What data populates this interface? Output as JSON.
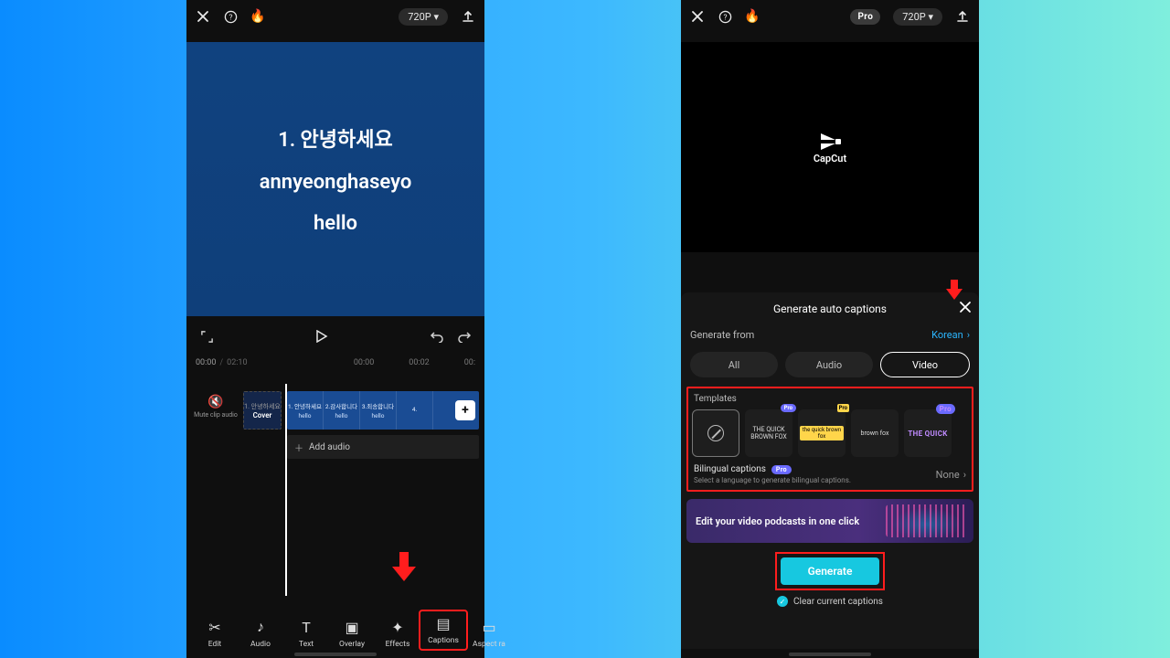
{
  "left": {
    "topbar": {
      "resolution": "720P ▾"
    },
    "preview": {
      "line1": "1. 안녕하세요",
      "line2": "annyeonghaseyo",
      "line3": "hello"
    },
    "time": {
      "cur": "00:00",
      "dur": "02:10",
      "t1": "00:00",
      "t2": "00:02",
      "t3": "00:"
    },
    "mute": "Mute clip audio",
    "cover": "Cover",
    "frames": [
      {
        "ko": "1. 안녕하세요",
        "en": "hello"
      },
      {
        "ko": "2.감사합니다",
        "en": "hello"
      },
      {
        "ko": "3.죄송합니다",
        "en": "hello"
      },
      {
        "ko": "4.",
        "en": ""
      }
    ],
    "addaudio": "Add audio",
    "toolbar": [
      "Edit",
      "Audio",
      "Text",
      "Overlay",
      "Effects",
      "Captions",
      "Aspect ra"
    ]
  },
  "right": {
    "topbar": {
      "pro": "Pro",
      "resolution": "720P ▾"
    },
    "brand": "CapCut",
    "panel": {
      "title": "Generate auto captions",
      "generate_from": "Generate from",
      "language": "Korean",
      "sources": [
        "All",
        "Audio",
        "Video"
      ],
      "templates_label": "Templates",
      "templates": [
        {
          "type": "none"
        },
        {
          "type": "plain",
          "text": "THE QUICK BROWN FOX",
          "pro": true
        },
        {
          "type": "ylw",
          "text": "the quick brown fox",
          "pro": true
        },
        {
          "type": "plain2",
          "text": "brown fox"
        },
        {
          "type": "purple",
          "text": "THE QUICK",
          "pro": true
        }
      ],
      "bilingual_title": "Bilingual captions",
      "bilingual_sub": "Select a language to generate bilingual captions.",
      "bilingual_value": "None",
      "banner": "Edit your video podcasts in one click",
      "generate": "Generate",
      "clear": "Clear current captions"
    }
  }
}
